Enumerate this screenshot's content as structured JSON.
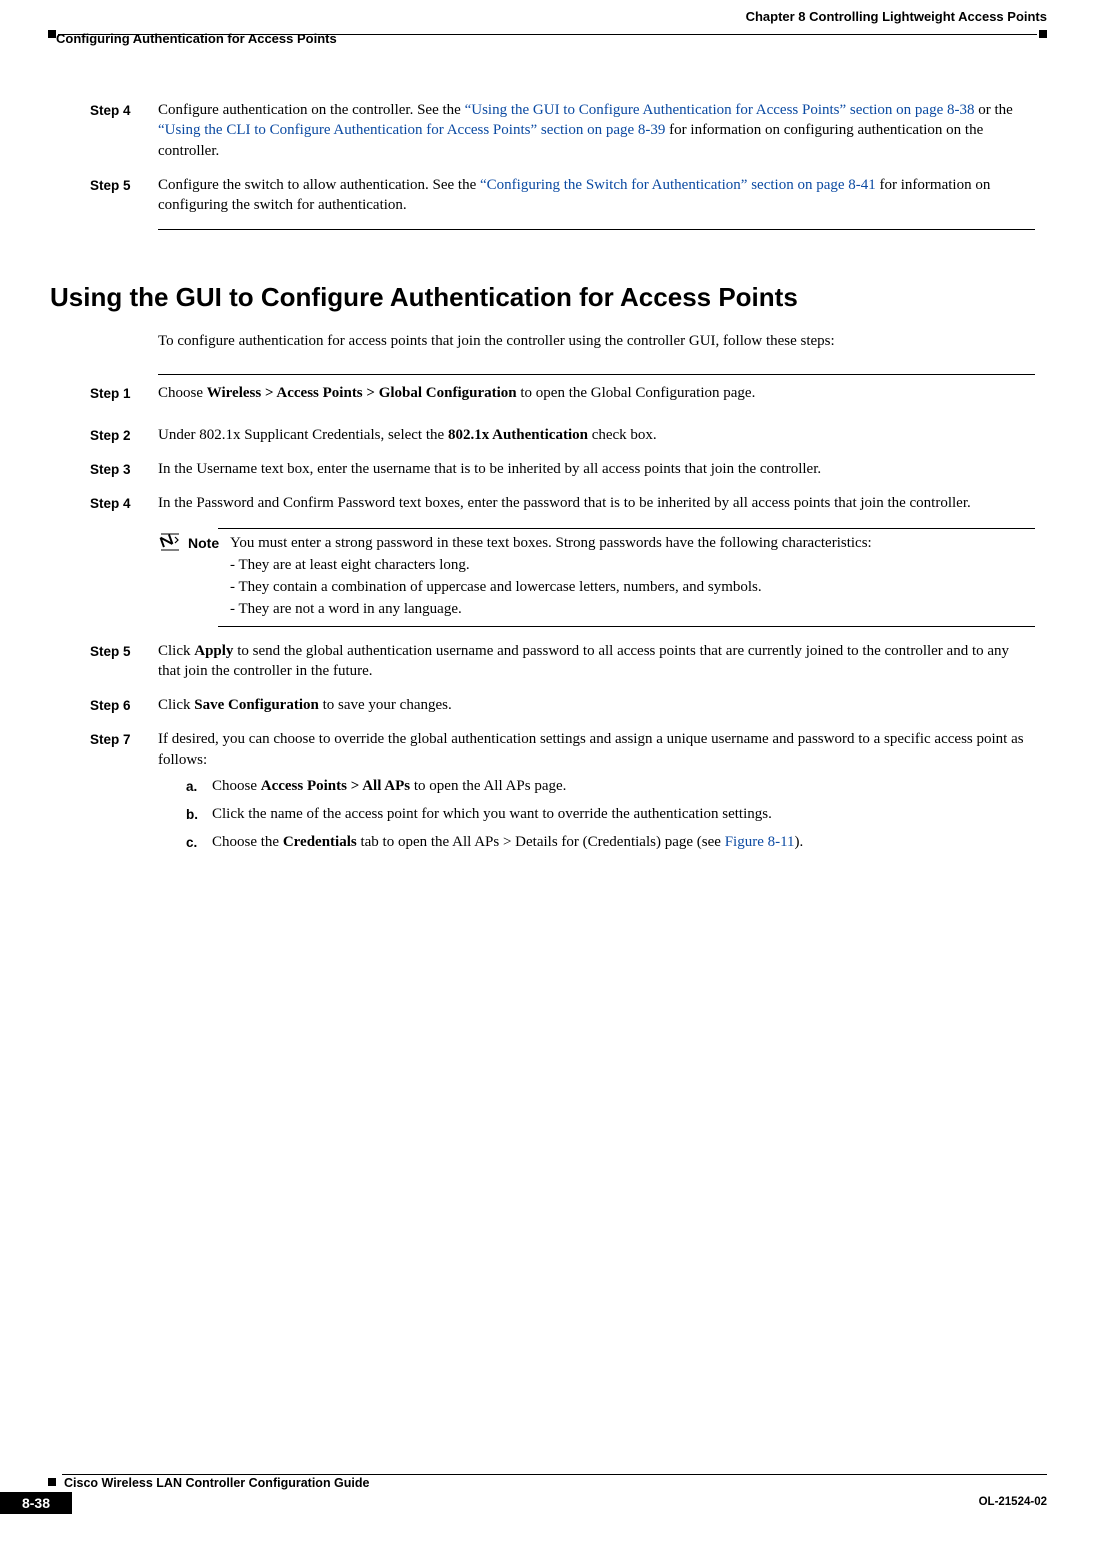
{
  "header": {
    "chapter": "Chapter 8      Controlling Lightweight Access Points",
    "section": "Configuring Authentication for Access Points"
  },
  "topSteps": {
    "s4": {
      "label": "Step 4",
      "pre": "Configure authentication on the controller. See the ",
      "link1": "“Using the GUI to Configure Authentication for Access Points” section on page 8-38",
      "mid": " or the ",
      "link2": "“Using the CLI to Configure Authentication for Access Points” section on page 8-39",
      "post": " for information on configuring authentication on the controller."
    },
    "s5": {
      "label": "Step 5",
      "pre": "Configure the switch to allow authentication. See the ",
      "link1": "“Configuring the Switch for Authentication” section on page 8-41",
      "post": " for information on configuring the switch for authentication."
    }
  },
  "sectionTitle": "Using the GUI to Configure Authentication for Access Points",
  "intro": "To configure authentication for access points that join the controller using the controller GUI, follow these steps:",
  "steps": {
    "s1": {
      "label": "Step 1",
      "t1": "Choose ",
      "b1": "Wireless > Access Points > Global Configuration",
      "t2": " to open the Global Configuration page."
    },
    "s2": {
      "label": "Step 2",
      "t1": "Under 802.1x Supplicant Credentials, select the ",
      "b1": "802.1x Authentication",
      "t2": " check box."
    },
    "s3": {
      "label": "Step 3",
      "t1": "In the Username text box, enter the username that is to be inherited by all access points that join the controller."
    },
    "s4": {
      "label": "Step 4",
      "t1": "In the Password and Confirm Password text boxes, enter the password that is to be inherited by all access points that join the controller."
    },
    "note": {
      "label": "Note",
      "intro": "You must enter a strong password in these text boxes. Strong passwords have the following characteristics:",
      "bul1": "- They are at least eight characters long.",
      "bul2": "- They contain a combination of uppercase and lowercase letters, numbers, and symbols.",
      "bul3": "- They are not a word in any language."
    },
    "s5": {
      "label": "Step 5",
      "t1": "Click ",
      "b1": "Apply",
      "t2": " to send the global authentication username and password to all access points that are currently joined to the controller and to any that join the controller in the future."
    },
    "s6": {
      "label": "Step 6",
      "t1": "Click ",
      "b1": "Save Configuration",
      "t2": " to save your changes."
    },
    "s7": {
      "label": "Step 7",
      "t1": "If desired, you can choose to override the global authentication settings and assign a unique username and password to a specific access point as follows:",
      "a": {
        "letter": "a.",
        "t1": "Choose ",
        "b1": "Access Points > All APs",
        "t2": " to open the All APs page."
      },
      "b": {
        "letter": "b.",
        "t1": "Click the name of the access point for which you want to override the authentication settings."
      },
      "c": {
        "letter": "c.",
        "t1": "Choose the ",
        "b1": "Credentials",
        "t2": " tab to open the All APs > Details for (Credentials) page (see ",
        "link1": "Figure 8-11",
        "t3": ")."
      }
    }
  },
  "footer": {
    "guide": "Cisco Wireless LAN Controller Configuration Guide",
    "page": "8-38",
    "doc": "OL-21524-02"
  }
}
